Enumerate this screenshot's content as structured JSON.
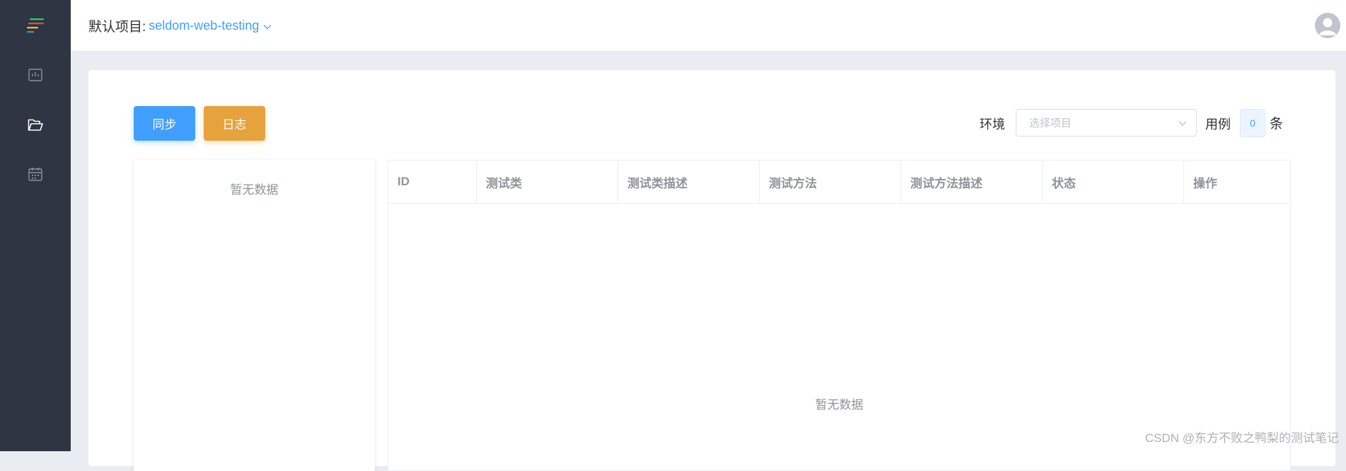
{
  "header": {
    "project_label": "默认项目:",
    "project_value": "seldom-web-testing"
  },
  "sidebar": {
    "items": [
      {
        "icon": "dashboard-icon"
      },
      {
        "icon": "folder-icon"
      },
      {
        "icon": "calendar-icon"
      }
    ]
  },
  "toolbar": {
    "sync_label": "同步",
    "log_label": "日志",
    "env_label": "环境",
    "env_placeholder": "选择项目",
    "case_label": "用例",
    "case_count": "0",
    "case_unit": "条"
  },
  "tree": {
    "empty_text": "暂无数据"
  },
  "table": {
    "columns": [
      "ID",
      "测试类",
      "测试类描述",
      "测试方法",
      "测试方法描述",
      "状态",
      "操作"
    ],
    "empty_text": "暂无数据"
  },
  "watermark": "CSDN @东方不败之鸭梨的测试笔记",
  "colors": {
    "sidebar_bg": "#2f3542",
    "primary": "#409eff",
    "warning": "#e6a23c"
  }
}
